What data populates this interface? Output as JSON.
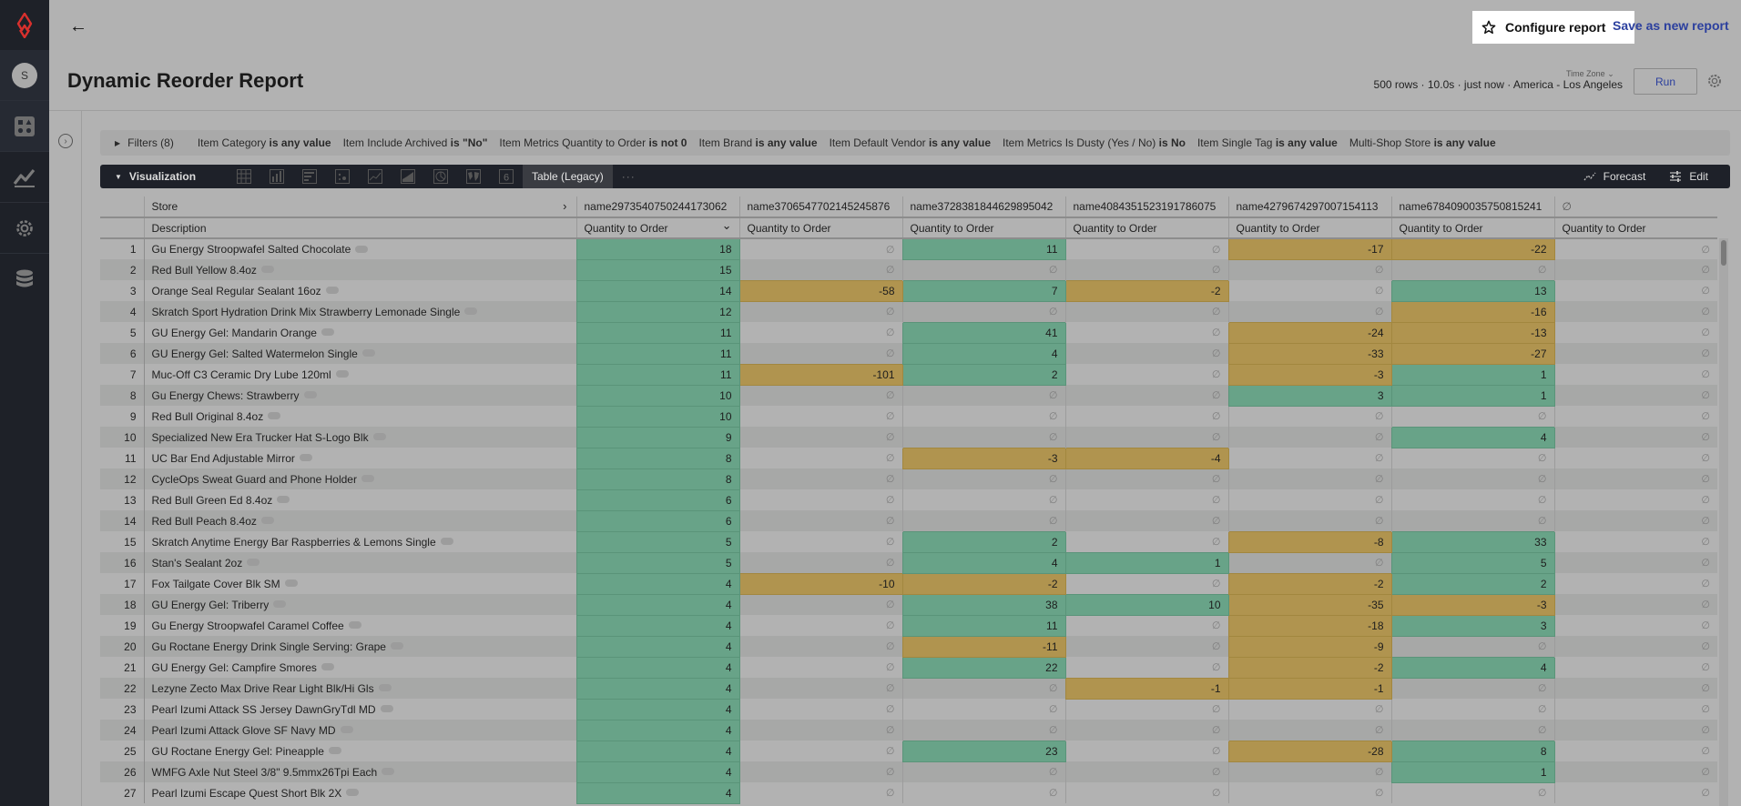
{
  "app": {
    "sidebar": {
      "avatar_initial": "S",
      "items": [
        {
          "name": "apps",
          "icon": "apps-icon"
        },
        {
          "name": "analytics",
          "icon": "trend-icon"
        },
        {
          "name": "settings",
          "icon": "gear-icon"
        },
        {
          "name": "database",
          "icon": "database-icon"
        }
      ]
    },
    "brand_color": "#d9302d"
  },
  "header": {
    "back_icon": "arrow-left-icon",
    "configure_label": "Configure report",
    "save_label": "Save as new report",
    "title": "Dynamic Reorder Report",
    "run_meta": "500 rows · 10.0s · just now · America - Los Angeles",
    "timezone_label": "Time Zone",
    "run_label": "Run"
  },
  "filters": {
    "toggle_label": "Filters (8)",
    "items": [
      {
        "field": "Item Category",
        "cond": "is any value"
      },
      {
        "field": "Item Include Archived",
        "cond": "is \"No\""
      },
      {
        "field": "Item Metrics Quantity to Order",
        "cond": "is not 0"
      },
      {
        "field": "Item Brand",
        "cond": "is any value"
      },
      {
        "field": "Item Default Vendor",
        "cond": "is any value"
      },
      {
        "field": "Item Metrics Is Dusty (Yes / No)",
        "cond": "is No"
      },
      {
        "field": "Item Single Tag",
        "cond": "is any value"
      },
      {
        "field": "Multi-Shop Store",
        "cond": "is any value"
      }
    ]
  },
  "visualization": {
    "toggle_label": "Visualization",
    "types": [
      "table",
      "column",
      "bar",
      "scatter",
      "line",
      "area",
      "pie",
      "map",
      "single-value"
    ],
    "active_label": "Table (Legacy)",
    "forecast_label": "Forecast",
    "edit_label": "Edit"
  },
  "table": {
    "pivot_label": "Store",
    "dimension_label": "Description",
    "null_symbol": "∅",
    "stores": [
      "name2973540750244173062",
      "name3706547702145245876",
      "name3728381844629895042",
      "name4084351523191786075",
      "name4279674297007154113",
      "name6784090035750815241",
      "∅"
    ],
    "measure_label": "Quantity to Order",
    "colors": {
      "positive": "#68a388",
      "negative": "#b0944f"
    },
    "rows": [
      {
        "n": "1",
        "desc": "Gu Energy Stroopwafel Salted Chocolate",
        "v": [
          18,
          null,
          11,
          null,
          -17,
          -22,
          null
        ]
      },
      {
        "n": "2",
        "desc": "Red Bull Yellow 8.4oz",
        "v": [
          15,
          null,
          null,
          null,
          null,
          null,
          null
        ]
      },
      {
        "n": "3",
        "desc": "Orange Seal Regular Sealant 16oz",
        "v": [
          14,
          -58,
          7,
          -2,
          null,
          13,
          null
        ]
      },
      {
        "n": "4",
        "desc": "Skratch Sport Hydration Drink Mix Strawberry Lemonade Single",
        "v": [
          12,
          null,
          null,
          null,
          null,
          -16,
          null
        ]
      },
      {
        "n": "5",
        "desc": "GU Energy Gel: Mandarin Orange",
        "v": [
          11,
          null,
          41,
          null,
          -24,
          -13,
          null
        ]
      },
      {
        "n": "6",
        "desc": "GU Energy Gel: Salted Watermelon Single",
        "v": [
          11,
          null,
          4,
          null,
          -33,
          -27,
          null
        ]
      },
      {
        "n": "7",
        "desc": "Muc-Off C3 Ceramic Dry Lube 120ml",
        "v": [
          11,
          -101,
          2,
          null,
          -3,
          1,
          null
        ]
      },
      {
        "n": "8",
        "desc": "Gu Energy Chews: Strawberry",
        "v": [
          10,
          null,
          null,
          null,
          3,
          1,
          null
        ]
      },
      {
        "n": "9",
        "desc": "Red Bull Original 8.4oz",
        "v": [
          10,
          null,
          null,
          null,
          null,
          null,
          null
        ]
      },
      {
        "n": "10",
        "desc": "Specialized New Era Trucker Hat S-Logo Blk",
        "v": [
          9,
          null,
          null,
          null,
          null,
          4,
          null
        ]
      },
      {
        "n": "11",
        "desc": "UC Bar End Adjustable Mirror",
        "v": [
          8,
          null,
          -3,
          -4,
          null,
          null,
          null
        ]
      },
      {
        "n": "12",
        "desc": "CycleOps Sweat Guard and Phone Holder",
        "v": [
          8,
          null,
          null,
          null,
          null,
          null,
          null
        ]
      },
      {
        "n": "13",
        "desc": "Red Bull Green Ed 8.4oz",
        "v": [
          6,
          null,
          null,
          null,
          null,
          null,
          null
        ]
      },
      {
        "n": "14",
        "desc": "Red Bull Peach 8.4oz",
        "v": [
          6,
          null,
          null,
          null,
          null,
          null,
          null
        ]
      },
      {
        "n": "15",
        "desc": "Skratch Anytime Energy Bar Raspberries & Lemons Single",
        "v": [
          5,
          null,
          2,
          null,
          -8,
          33,
          null
        ]
      },
      {
        "n": "16",
        "desc": "Stan's Sealant 2oz",
        "v": [
          5,
          null,
          4,
          1,
          null,
          5,
          null
        ]
      },
      {
        "n": "17",
        "desc": "Fox Tailgate Cover Blk SM",
        "v": [
          4,
          -10,
          -2,
          null,
          -2,
          2,
          null
        ]
      },
      {
        "n": "18",
        "desc": "GU Energy Gel: Triberry",
        "v": [
          4,
          null,
          38,
          10,
          -35,
          -3,
          null
        ]
      },
      {
        "n": "19",
        "desc": "Gu Energy Stroopwafel Caramel Coffee",
        "v": [
          4,
          null,
          11,
          null,
          -18,
          3,
          null
        ]
      },
      {
        "n": "20",
        "desc": "Gu Roctane Energy Drink Single Serving: Grape",
        "v": [
          4,
          null,
          -11,
          null,
          -9,
          null,
          null
        ]
      },
      {
        "n": "21",
        "desc": "GU Energy Gel: Campfire Smores",
        "v": [
          4,
          null,
          22,
          null,
          -2,
          4,
          null
        ]
      },
      {
        "n": "22",
        "desc": "Lezyne Zecto Max Drive Rear Light Blk/Hi Gls",
        "v": [
          4,
          null,
          null,
          -1,
          -1,
          null,
          null
        ]
      },
      {
        "n": "23",
        "desc": "Pearl Izumi Attack SS Jersey DawnGryTdl MD",
        "v": [
          4,
          null,
          null,
          null,
          null,
          null,
          null
        ]
      },
      {
        "n": "24",
        "desc": "Pearl Izumi Attack Glove SF Navy MD",
        "v": [
          4,
          null,
          null,
          null,
          null,
          null,
          null
        ]
      },
      {
        "n": "25",
        "desc": "GU Roctane Energy Gel: Pineapple",
        "v": [
          4,
          null,
          23,
          null,
          -28,
          8,
          null
        ]
      },
      {
        "n": "26",
        "desc": "WMFG Axle Nut Steel 3/8\" 9.5mmx26Tpi Each",
        "v": [
          4,
          null,
          null,
          null,
          null,
          1,
          null
        ]
      },
      {
        "n": "27",
        "desc": "Pearl Izumi Escape Quest Short Blk 2X",
        "v": [
          4,
          null,
          null,
          null,
          null,
          null,
          null
        ]
      }
    ]
  }
}
